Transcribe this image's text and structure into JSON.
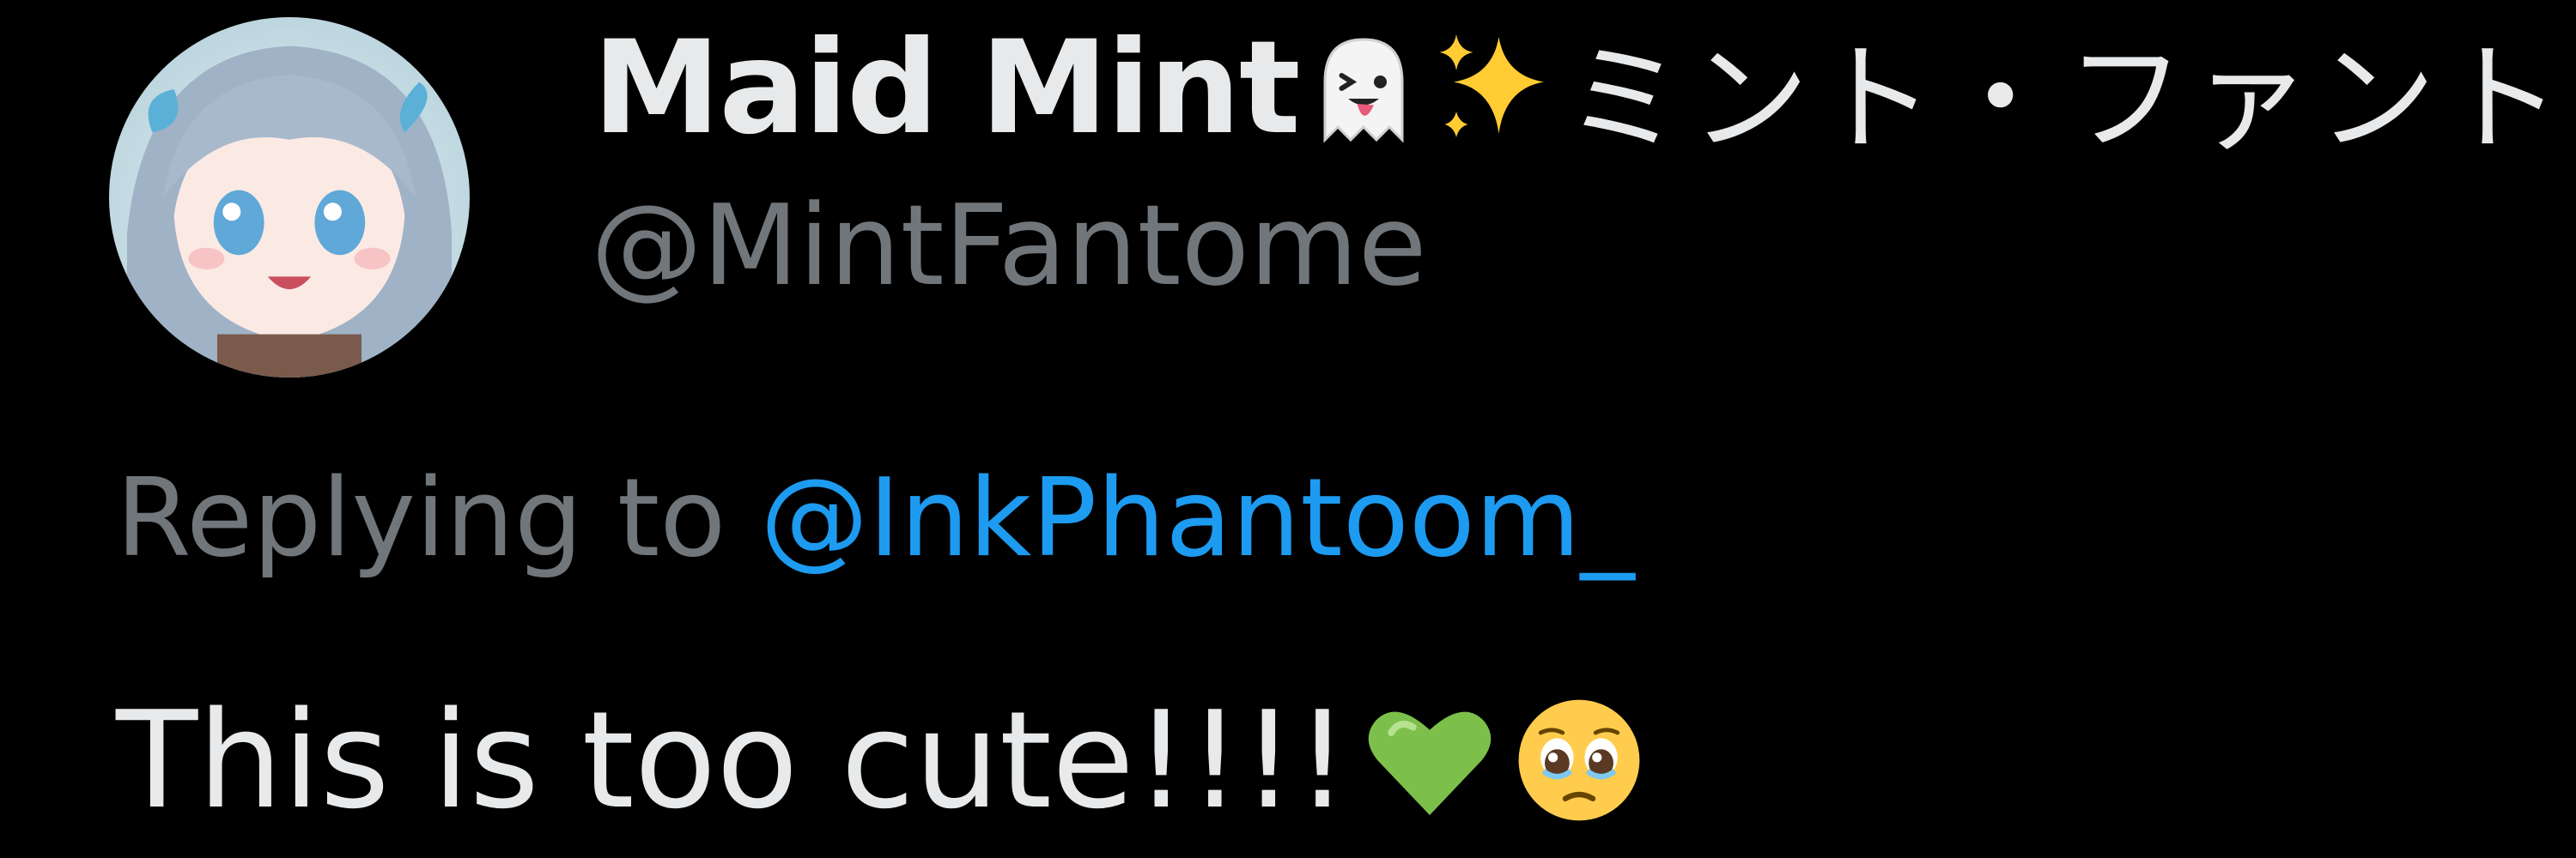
{
  "tweet": {
    "author": {
      "display_name": "Maid Mint",
      "display_name_suffix": "ミント・ファント",
      "name_emojis": [
        "ghost-tongue-emoji",
        "sparkles-emoji"
      ],
      "handle": "@MintFantome"
    },
    "reply": {
      "prefix": "Replying to ",
      "mention": "@InkPhantoom_"
    },
    "text": "This is too cute!!!!",
    "text_emojis": [
      "green-heart-emoji",
      "pleading-face-emoji"
    ]
  },
  "colors": {
    "background": "#000000",
    "primary_text": "#e7e9ea",
    "secondary_text": "#71767b",
    "mention": "#1d9bf0"
  }
}
